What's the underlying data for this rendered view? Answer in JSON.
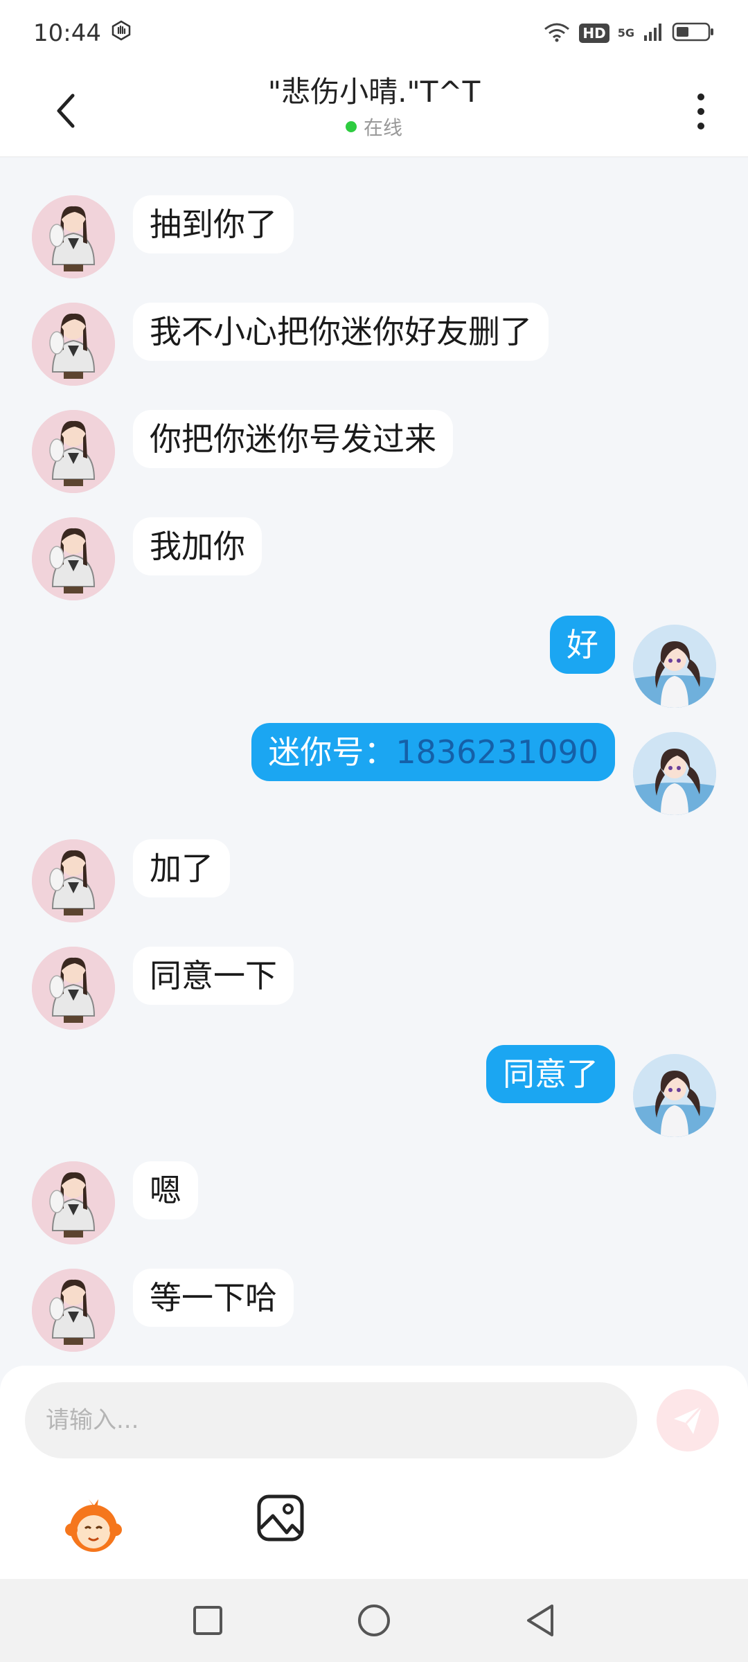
{
  "status_bar": {
    "time": "10:44",
    "hd": "HD",
    "network": "5G"
  },
  "header": {
    "title": "\"悲伤小晴.\"T^T",
    "status": "在线",
    "status_color": "#2ecc40"
  },
  "messages": [
    {
      "side": "left",
      "text": "抽到你了"
    },
    {
      "side": "left",
      "text": "我不小心把你迷你好友删了"
    },
    {
      "side": "left",
      "text": "你把你迷你号发过来"
    },
    {
      "side": "left",
      "text": "我加你"
    },
    {
      "side": "right",
      "text": "好"
    },
    {
      "side": "right",
      "label": "迷你号：",
      "number": "1836231090"
    },
    {
      "side": "left",
      "text": "加了"
    },
    {
      "side": "left",
      "text": "同意一下"
    },
    {
      "side": "right",
      "text": "同意了"
    },
    {
      "side": "left",
      "text": "嗯"
    },
    {
      "side": "left",
      "text": "等一下哈"
    }
  ],
  "input": {
    "placeholder": "请输入...",
    "value": ""
  },
  "icons": {
    "back": "chevron-left-icon",
    "more": "more-vertical-icon",
    "send": "send-icon",
    "emoji": "emoji-icon",
    "image": "image-icon",
    "nav_recent": "square-icon",
    "nav_home": "circle-icon",
    "nav_back": "triangle-back-icon"
  },
  "colors": {
    "accent_bubble": "#1ba6f2",
    "background": "#f4f6f9",
    "send_button": "#fde6e8"
  }
}
